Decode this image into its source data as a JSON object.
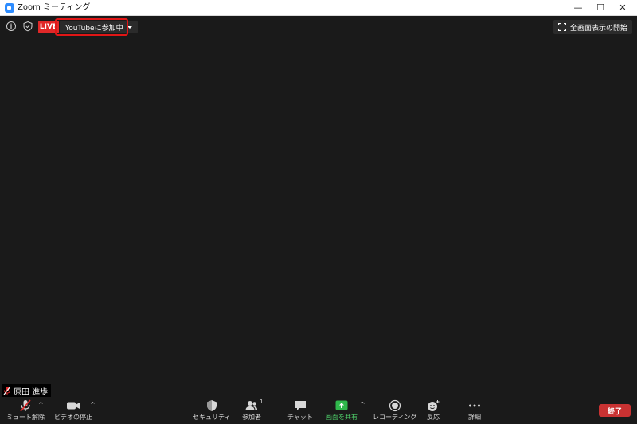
{
  "window": {
    "title": "Zoom ミーティング",
    "minimize": "—",
    "maximize": "☐",
    "close": "✕"
  },
  "top": {
    "live_badge": "LIVE",
    "live_status": "YouTubeに参加中",
    "fullscreen_label": "全画面表示の開始"
  },
  "participant": {
    "name": "原田 進歩"
  },
  "toolbar": {
    "mute": "ミュート解除",
    "video": "ビデオの停止",
    "security": "セキュリティ",
    "participants": "参加者",
    "participants_count": "1",
    "chat": "チャット",
    "share": "画面を共有",
    "record": "レコーディング",
    "reactions": "反応",
    "more": "詳細",
    "end": "終了",
    "caret": "^"
  },
  "colors": {
    "background": "#1a1a1a",
    "live_red": "#e02828",
    "share_green": "#4fd16b",
    "end_red": "#c93232",
    "highlight_red": "#e01616"
  }
}
